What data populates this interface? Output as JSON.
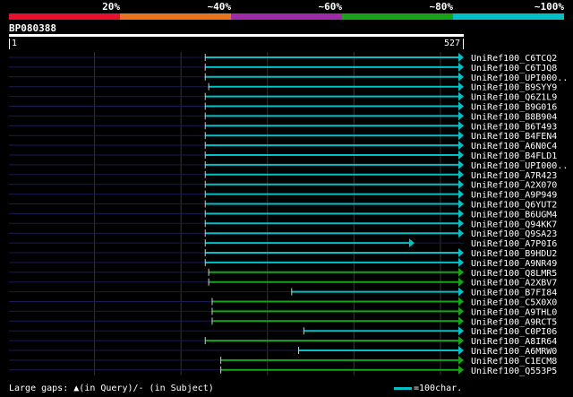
{
  "scale": {
    "segments": [
      {
        "color": "#e8102e",
        "label": "20%"
      },
      {
        "color": "#e87420",
        "label": "~40%"
      },
      {
        "color": "#a02aa8",
        "label": "~60%"
      },
      {
        "color": "#17a417",
        "label": "~80%"
      },
      {
        "color": "#00c0c8",
        "label": "~100%"
      }
    ]
  },
  "query": {
    "name": "BP080388",
    "start": "1",
    "end": "527",
    "length": 527
  },
  "hits": [
    {
      "label": "UniRef100_C6TCQ2",
      "start": 228,
      "end": 527,
      "color": "#00c0c8"
    },
    {
      "label": "UniRef100_C6TJQ8",
      "start": 228,
      "end": 527,
      "color": "#00c0c8"
    },
    {
      "label": "UniRef100_UPI000..",
      "start": 228,
      "end": 527,
      "color": "#00c0c8"
    },
    {
      "label": "UniRef100_B9SYY9",
      "start": 232,
      "end": 527,
      "color": "#00c0c8"
    },
    {
      "label": "UniRef100_Q6Z1L9",
      "start": 228,
      "end": 527,
      "color": "#00c0c8"
    },
    {
      "label": "UniRef100_B9G016",
      "start": 228,
      "end": 527,
      "color": "#00c0c8"
    },
    {
      "label": "UniRef100_B8B904",
      "start": 228,
      "end": 527,
      "color": "#00c0c8"
    },
    {
      "label": "UniRef100_B6T493",
      "start": 228,
      "end": 527,
      "color": "#00c0c8"
    },
    {
      "label": "UniRef100_B4FEN4",
      "start": 228,
      "end": 527,
      "color": "#00c0c8"
    },
    {
      "label": "UniRef100_A6N0C4",
      "start": 228,
      "end": 527,
      "color": "#00c0c8"
    },
    {
      "label": "UniRef100_B4FLD1",
      "start": 228,
      "end": 527,
      "color": "#00c0c8"
    },
    {
      "label": "UniRef100_UPI000..",
      "start": 228,
      "end": 527,
      "color": "#00c0c8"
    },
    {
      "label": "UniRef100_A7R423",
      "start": 228,
      "end": 527,
      "color": "#00c0c8"
    },
    {
      "label": "UniRef100_A2X070",
      "start": 228,
      "end": 527,
      "color": "#00c0c8"
    },
    {
      "label": "UniRef100_A9P949",
      "start": 228,
      "end": 527,
      "color": "#00c0c8"
    },
    {
      "label": "UniRef100_Q6YUT2",
      "start": 228,
      "end": 527,
      "color": "#00c0c8"
    },
    {
      "label": "UniRef100_B6UGM4",
      "start": 228,
      "end": 527,
      "color": "#00c0c8"
    },
    {
      "label": "UniRef100_Q94KK7",
      "start": 228,
      "end": 527,
      "color": "#00c0c8"
    },
    {
      "label": "UniRef100_Q9SA23",
      "start": 228,
      "end": 527,
      "color": "#00c0c8"
    },
    {
      "label": "UniRef100_A7P0I6",
      "start": 228,
      "end": 470,
      "color": "#00c0c8"
    },
    {
      "label": "UniRef100_B9HDU2",
      "start": 228,
      "end": 527,
      "color": "#00c0c8"
    },
    {
      "label": "UniRef100_A9NR49",
      "start": 228,
      "end": 527,
      "color": "#00c0c8"
    },
    {
      "label": "UniRef100_Q8LMR5",
      "start": 232,
      "end": 527,
      "color": "#17a417"
    },
    {
      "label": "UniRef100_A2XBV7",
      "start": 232,
      "end": 527,
      "color": "#17a417"
    },
    {
      "label": "UniRef100_B7FI84",
      "start": 328,
      "end": 527,
      "color": "#00c0c8"
    },
    {
      "label": "UniRef100_C5X0X0",
      "start": 236,
      "end": 527,
      "color": "#17a417"
    },
    {
      "label": "UniRef100_A9THL0",
      "start": 236,
      "end": 527,
      "color": "#17a417"
    },
    {
      "label": "UniRef100_A9RCT5",
      "start": 236,
      "end": 527,
      "color": "#17a417"
    },
    {
      "label": "UniRef100_C0PI06",
      "start": 342,
      "end": 527,
      "color": "#00c0c8"
    },
    {
      "label": "UniRef100_A8IR64",
      "start": 228,
      "end": 527,
      "color": "#17a417"
    },
    {
      "label": "UniRef100_A6MRW0",
      "start": 336,
      "end": 527,
      "color": "#00c0c8"
    },
    {
      "label": "UniRef100_C1ECM8",
      "start": 246,
      "end": 527,
      "color": "#17a417"
    },
    {
      "label": "UniRef100_Q553P5",
      "start": 246,
      "end": 527,
      "color": "#17a417"
    }
  ],
  "footer": {
    "gaps_text": "Large gaps: ",
    "gap_marker": "▲",
    "gaps_rest": "(in Query)/- (in Subject)",
    "legend_text": "=100char."
  }
}
